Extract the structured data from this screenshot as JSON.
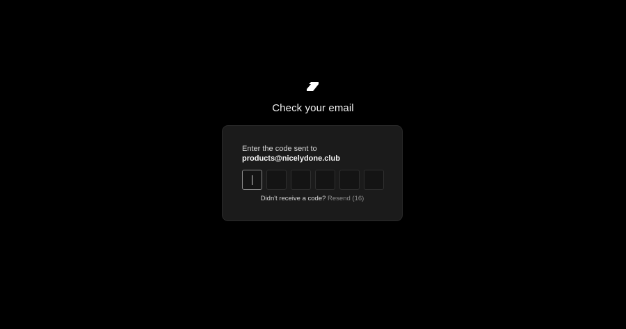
{
  "logo": {
    "icon": "brand-logo-icon"
  },
  "header": {
    "title": "Check your email"
  },
  "card": {
    "prompt": "Enter the code sent to",
    "email": "products@nicelydone.club",
    "code_boxes": [
      "",
      "",
      "",
      "",
      "",
      ""
    ],
    "resend": {
      "question": "Didn't receive a code?",
      "link_label": "Resend (16)"
    }
  },
  "colors": {
    "background": "#000000",
    "card": "#1b1b1b",
    "box_border": "#2e2e2e",
    "active_border": "#8a8a8a",
    "link": "#8c8c8c"
  }
}
